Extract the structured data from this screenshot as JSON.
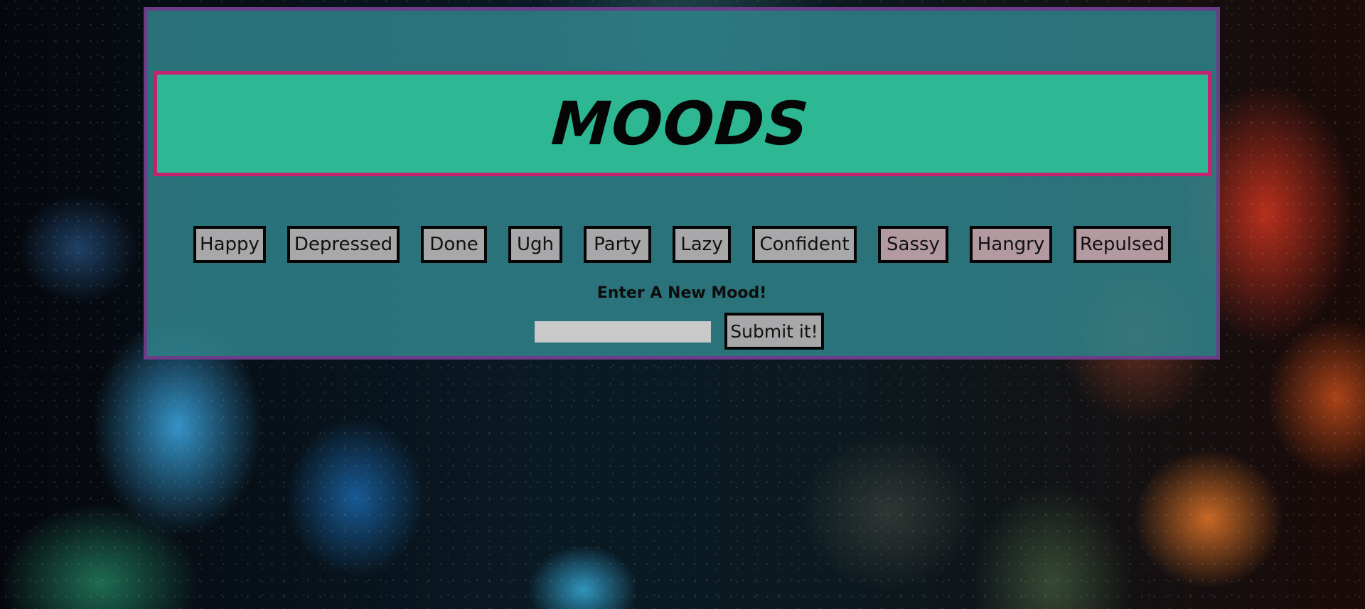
{
  "page": {
    "title": "MOODS",
    "new_mood_label": "Enter A New Mood!",
    "input_value": "",
    "input_placeholder": "",
    "submit_label": "Submit it!"
  },
  "moods": [
    "Happy",
    "Depressed",
    "Done",
    "Ugh",
    "Party",
    "Lazy",
    "Confident",
    "Sassy",
    "Hangry",
    "Repulsed"
  ],
  "colors": {
    "panel_border": "#6b3c88",
    "panel_fill": "#30828a",
    "title_border": "#c2246f",
    "title_fill": "#2ec096",
    "button_fill": "#a8a8aa",
    "button_fill_warm": "#b39aa0",
    "button_border": "#050505"
  }
}
